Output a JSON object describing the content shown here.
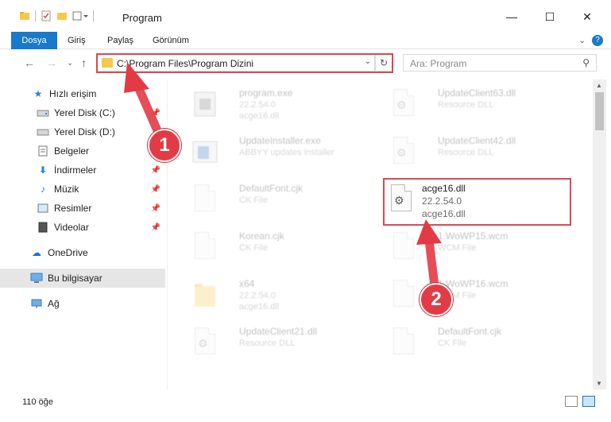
{
  "window": {
    "title": "Program",
    "controls": {
      "minimize": "—",
      "maximize": "☐",
      "close": "✕"
    }
  },
  "ribbon": {
    "tabs": [
      "Dosya",
      "Giriş",
      "Paylaş",
      "Görünüm"
    ],
    "accent": "#1979ca"
  },
  "nav": {
    "address": "C:\\Program Files\\Program Dizini",
    "search_placeholder": "Ara: Program"
  },
  "sidebar": {
    "items": [
      {
        "label": "Hızlı erişim",
        "icon": "star-icon"
      },
      {
        "label": "Yerel Disk (C:)",
        "icon": "drive-icon"
      },
      {
        "label": "Yerel Disk (D:)",
        "icon": "drive-icon"
      },
      {
        "label": "Belgeler",
        "icon": "documents-icon"
      },
      {
        "label": "İndirmeler",
        "icon": "download-icon"
      },
      {
        "label": "Müzik",
        "icon": "music-icon"
      },
      {
        "label": "Resimler",
        "icon": "pictures-icon"
      },
      {
        "label": "Videolar",
        "icon": "videos-icon"
      },
      {
        "label": "OneDrive",
        "icon": "cloud-icon"
      },
      {
        "label": "Bu bilgisayar",
        "icon": "computer-icon"
      },
      {
        "label": "Ağ",
        "icon": "network-icon"
      }
    ]
  },
  "files": [
    {
      "name": "program.exe",
      "meta1": "22.2.54.0",
      "meta2": "acge16.dll"
    },
    {
      "name": "UpdateClient63.dll",
      "meta1": "Resource DLL",
      "meta2": ""
    },
    {
      "name": "UpdateInstaller.exe",
      "meta1": "ABBYY updates installer",
      "meta2": ""
    },
    {
      "name": "UpdateClient42.dll",
      "meta1": "Resource DLL",
      "meta2": ""
    },
    {
      "name": "DefaultFont.cjk",
      "meta1": "CK File",
      "meta2": ""
    },
    {
      "name": "acge16.dll",
      "meta1": "22.2.54.0",
      "meta2": "acge16.dll"
    },
    {
      "name": "Korean.cjk",
      "meta1": "CK File",
      "meta2": ""
    },
    {
      "name": "1.WoWP15.wcm",
      "meta1": "WCM File",
      "meta2": ""
    },
    {
      "name": "x64",
      "meta1": "22.2.54.0",
      "meta2": "acge16.dll"
    },
    {
      "name": "1.WoWP16.wcm",
      "meta1": "WCM File",
      "meta2": ""
    },
    {
      "name": "UpdateClient21.dll",
      "meta1": "Resource DLL",
      "meta2": ""
    },
    {
      "name": "DefaultFont.cjk",
      "meta1": "CK File",
      "meta2": ""
    }
  ],
  "status": {
    "item_count": "110 öğe"
  },
  "annotations": {
    "step1": "1",
    "step2": "2",
    "color": "#e23b45"
  }
}
